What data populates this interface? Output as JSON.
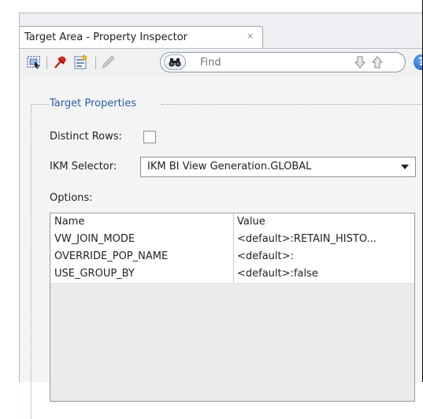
{
  "tab": {
    "title": "Target Area - Property Inspector",
    "close_glyph": "×"
  },
  "toolbar": {
    "icons": [
      "select-icon",
      "pin-icon",
      "edit-icon",
      "pencil-icon",
      "binoculars-icon",
      "find-next-icon",
      "find-previous-icon",
      "help-icon"
    ],
    "search_placeholder": "Find",
    "help_glyph": "?"
  },
  "target_properties": {
    "title": "Target Properties",
    "distinct_rows_label": "Distinct Rows:",
    "distinct_rows_checked": false,
    "ikm_selector_label": "IKM Selector:",
    "ikm_selector_value": "IKM BI View Generation.GLOBAL",
    "options_label": "Options:"
  },
  "options_table": {
    "columns": [
      "Name",
      "Value"
    ],
    "rows": [
      {
        "name": "VW_JOIN_MODE",
        "value": "<default>:RETAIN_HISTO..."
      },
      {
        "name": "OVERRIDE_POP_NAME",
        "value": "<default>:"
      },
      {
        "name": "USE_GROUP_BY",
        "value": "<default>:false"
      }
    ]
  },
  "colors": {
    "accent": "#2a5fa8",
    "panel_bg": "#f4f4f4"
  }
}
